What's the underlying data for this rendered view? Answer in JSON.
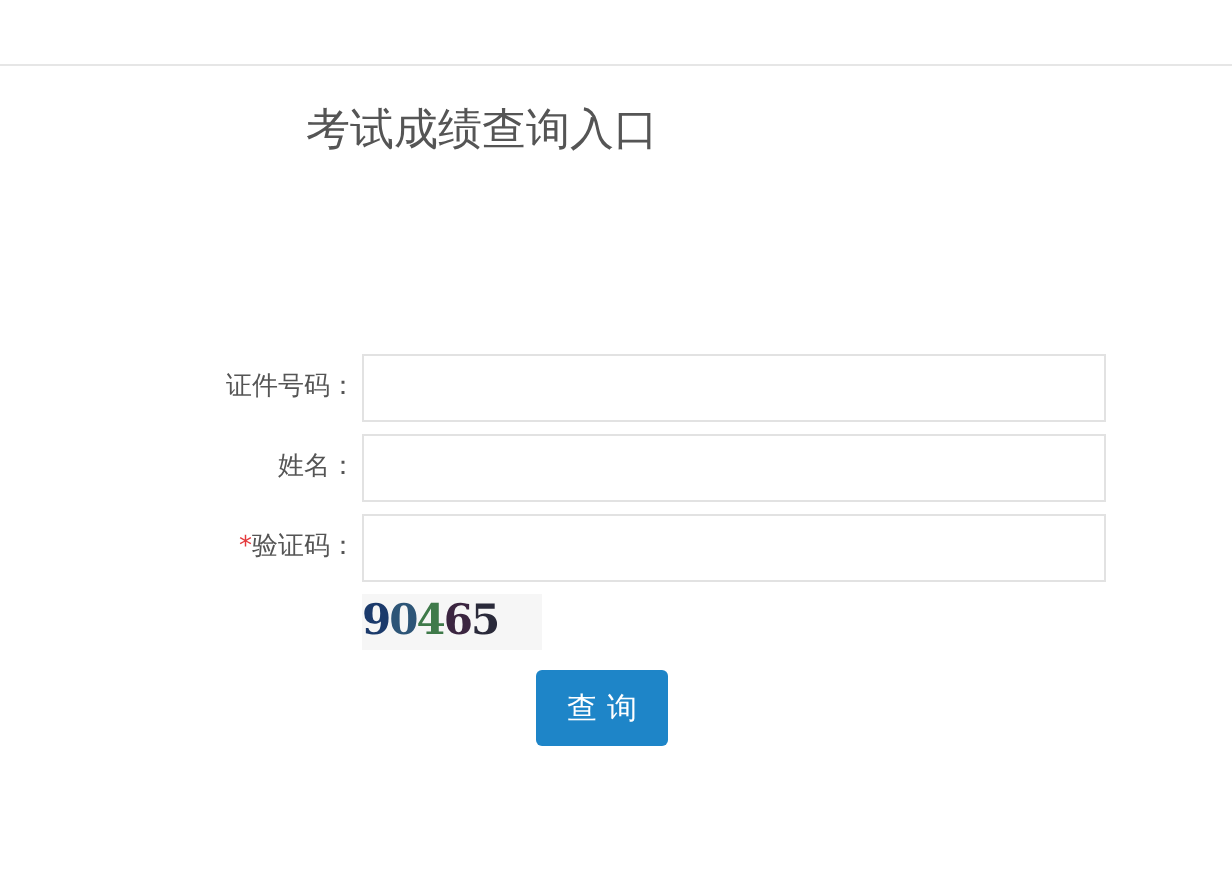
{
  "title": "考试成绩查询入口",
  "fields": [
    {
      "label": "证件号码："
    },
    {
      "label": "姓名："
    },
    {
      "label": "验证码：",
      "marker": "*"
    }
  ],
  "captcha": "90465",
  "submit": "查 询"
}
